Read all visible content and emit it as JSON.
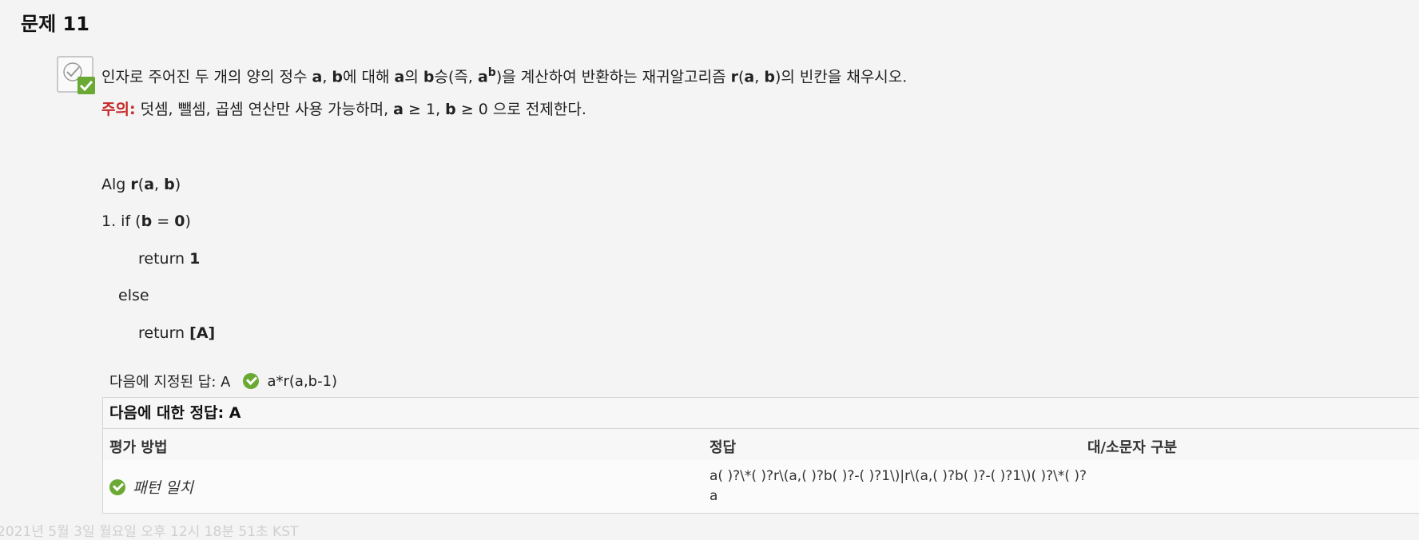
{
  "question": {
    "title": "문제 11",
    "prompt": {
      "p1": "인자로 주어진 두 개의 양의 정수 ",
      "a1": "a",
      "p2": ", ",
      "b1": "b",
      "p3": "에 대해 ",
      "a2": "a",
      "p4": "의 ",
      "b2": "b",
      "p5": "승(즉, ",
      "a3": "a",
      "sup": "b",
      "p6": ")을 계산하여 반환하는 재귀알고리즘 ",
      "r": "r",
      "p7": "(",
      "a4": "a",
      "p8": ", ",
      "b3": "b",
      "p9": ")의 빈칸을 채우시오."
    },
    "note": {
      "label": "주의:",
      "t1": " 덧셈, 뺄셈, 곱셈 연산만 사용 가능하며, ",
      "a": "a",
      "t2": " ≥ 1, ",
      "b": "b",
      "t3": " ≥ 0 으로 전제한다."
    },
    "algorithm": {
      "alg_kw": "Alg ",
      "r": "r",
      "open": "(",
      "a": "a",
      "sep": ", ",
      "b": "b",
      "close": ")",
      "if_pre": "1. if (",
      "if_b": "b",
      "if_eq": " = ",
      "if_zero": "0",
      "if_close": ")",
      "return_kw": "return ",
      "return_val": "1",
      "else_kw": "else",
      "return2_kw": "return ",
      "return2_val": "[A]"
    }
  },
  "given_answer": {
    "label": "다음에 지정된 답: A",
    "value": "a*r(a,b-1)"
  },
  "answer_table": {
    "header": "다음에 대한 정답: A",
    "columns": [
      "평가 방법",
      "정답",
      "대/소문자 구분"
    ],
    "row": {
      "method": "패턴 일치",
      "pattern": "a( )?\\*( )?r\\(a,( )?b( )?-( )?1\\)|r\\(a,( )?b( )?-( )?1\\)( )?\\*( )?a",
      "case_sensitive": ""
    }
  },
  "timestamp": "2021년 5월 3일 월요일 오후 12시 18분 51초 KST"
}
